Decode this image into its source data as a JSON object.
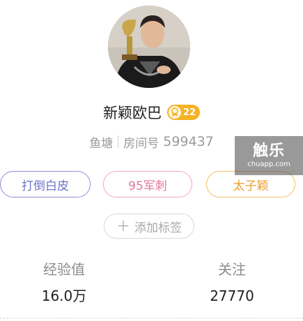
{
  "profile": {
    "name": "新颖欧巴",
    "level": "22",
    "location": "鱼塘",
    "room_label": "房间号",
    "room_number": "599437"
  },
  "tags": [
    {
      "label": "打倒白皮",
      "color": "#8c90d8"
    },
    {
      "label": "95军刺",
      "color": "#f0a7bf"
    },
    {
      "label": "太子颖",
      "color": "#f4be62"
    }
  ],
  "add_tag": {
    "icon": "plus-icon",
    "label": "添加标签"
  },
  "stats": {
    "exp_label": "经验值",
    "exp_value": "16.0万",
    "follow_label": "关注",
    "follow_value": "27770"
  },
  "watermark": {
    "main": "触乐",
    "sub": "chuapp.com"
  },
  "colors": {
    "level_badge": "#f5b324"
  }
}
